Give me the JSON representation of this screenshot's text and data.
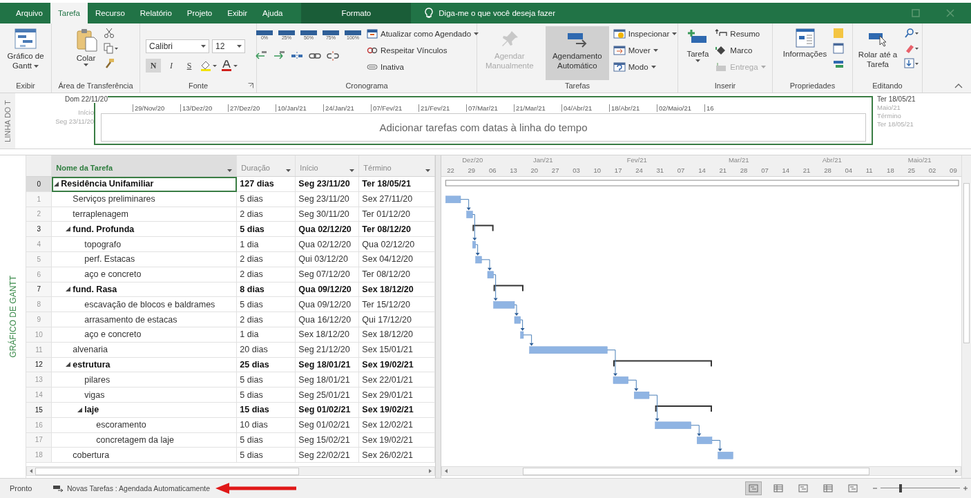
{
  "tabs": [
    {
      "label": "Arquivo",
      "selected": false,
      "kind": "normal"
    },
    {
      "label": "Tarefa",
      "selected": true,
      "kind": "normal"
    },
    {
      "label": "Recurso",
      "selected": false,
      "kind": "normal"
    },
    {
      "label": "Relatório",
      "selected": false,
      "kind": "normal"
    },
    {
      "label": "Projeto",
      "selected": false,
      "kind": "normal"
    },
    {
      "label": "Exibir",
      "selected": false,
      "kind": "normal"
    },
    {
      "label": "Ajuda",
      "selected": false,
      "kind": "normal"
    },
    {
      "label": "Formato",
      "selected": false,
      "kind": "contextual"
    }
  ],
  "tell_me": {
    "placeholder": "Diga-me o que você deseja fazer"
  },
  "ribbon": {
    "view": {
      "label": "Exibir",
      "gantt_button": "Gráfico de Gantt"
    },
    "clipboard": {
      "label": "Área de Transferência",
      "paste_button": "Colar"
    },
    "font": {
      "label": "Fonte",
      "family": "Calibri",
      "size": "12",
      "bold": "N",
      "italic": "I",
      "underline": "S"
    },
    "schedule": {
      "label": "Cronograma",
      "percent_labels": [
        "0%",
        "25%",
        "50%",
        "75%",
        "100%"
      ],
      "commands": [
        "Atualizar como Agendado",
        "Respeitar Vínculos",
        "Inativa"
      ]
    },
    "tasks": {
      "label": "Tarefas",
      "modes": [
        {
          "label": "Agendar Manualmente",
          "selected": false,
          "disabled": true
        },
        {
          "label": "Agendamento Automático",
          "selected": true,
          "disabled": false
        }
      ],
      "commands": [
        "Inspecionar",
        "Mover",
        "Modo"
      ]
    },
    "insert": {
      "label": "Inserir",
      "task_button": "Tarefa",
      "commands": [
        {
          "label": "Resumo",
          "disabled": false
        },
        {
          "label": "Marco",
          "disabled": false
        },
        {
          "label": "Entrega",
          "disabled": true
        }
      ]
    },
    "properties": {
      "label": "Propriedades",
      "info_button": "Informações"
    },
    "editing": {
      "label": "Editando",
      "scroll_button": "Rolar até a Tarefa"
    }
  },
  "timeline": {
    "side_label": "LINHA DO T",
    "start_top": "Dom 22/11/20",
    "start_caption": "Início",
    "start_date": "Seg 23/11/20",
    "ticks": [
      "29/Nov/20",
      "13/Dez/20",
      "27/Dez/20",
      "10/Jan/21",
      "24/Jan/21",
      "07/Fev/21",
      "21/Fev/21",
      "07/Mar/21",
      "21/Mar/21",
      "04/Abr/21",
      "18/Abr/21",
      "02/Maio/21",
      "16"
    ],
    "placeholder_text": "Adicionar tarefas com datas à linha do tempo",
    "end_top": "Ter 18/05/21",
    "end_month": "Maio/21",
    "end_caption": "Término",
    "end_date": "Ter 18/05/21"
  },
  "view_label": "GRÁFICO DE GANTT",
  "table": {
    "columns": [
      "Nome da Tarefa",
      "Duração",
      "Início",
      "Término"
    ],
    "rows": [
      {
        "num": "0",
        "name": "Residência Unifamiliar",
        "duration": "127 dias",
        "start": "Seg 23/11/20",
        "finish": "Ter 18/05/21",
        "kind": "summary",
        "expanded": true,
        "selected": true,
        "children": [
          {
            "num": "1",
            "name": "Serviços preliminares",
            "duration": "5 dias",
            "start": "Seg 23/11/20",
            "finish": "Sex 27/11/20",
            "kind": "task",
            "selected": false
          },
          {
            "num": "2",
            "name": "terraplenagem",
            "duration": "2 dias",
            "start": "Seg 30/11/20",
            "finish": "Ter 01/12/20",
            "kind": "task",
            "selected": false
          },
          {
            "num": "3",
            "name": "fund. Profunda",
            "duration": "5 dias",
            "start": "Qua 02/12/20",
            "finish": "Ter 08/12/20",
            "kind": "summary",
            "expanded": true,
            "selected": false,
            "children": [
              {
                "num": "4",
                "name": "topografo",
                "duration": "1 dia",
                "start": "Qua 02/12/20",
                "finish": "Qua 02/12/20",
                "kind": "task",
                "selected": false
              },
              {
                "num": "5",
                "name": "perf. Estacas",
                "duration": "2 dias",
                "start": "Qui 03/12/20",
                "finish": "Sex 04/12/20",
                "kind": "task",
                "selected": false
              },
              {
                "num": "6",
                "name": "aço e concreto",
                "duration": "2 dias",
                "start": "Seg 07/12/20",
                "finish": "Ter 08/12/20",
                "kind": "task",
                "selected": false
              }
            ]
          },
          {
            "num": "7",
            "name": "fund. Rasa",
            "duration": "8 dias",
            "start": "Qua 09/12/20",
            "finish": "Sex 18/12/20",
            "kind": "summary",
            "expanded": true,
            "selected": false,
            "children": [
              {
                "num": "8",
                "name": "escavação de blocos e baldrames",
                "duration": "5 dias",
                "start": "Qua 09/12/20",
                "finish": "Ter 15/12/20",
                "kind": "task",
                "selected": false
              },
              {
                "num": "9",
                "name": "arrasamento de estacas",
                "duration": "2 dias",
                "start": "Qua 16/12/20",
                "finish": "Qui 17/12/20",
                "kind": "task",
                "selected": false
              },
              {
                "num": "10",
                "name": "aço e concreto",
                "duration": "1 dia",
                "start": "Sex 18/12/20",
                "finish": "Sex 18/12/20",
                "kind": "task",
                "selected": false
              }
            ]
          },
          {
            "num": "11",
            "name": "alvenaria",
            "duration": "20 dias",
            "start": "Seg 21/12/20",
            "finish": "Sex 15/01/21",
            "kind": "task",
            "selected": false
          },
          {
            "num": "12",
            "name": "estrutura",
            "duration": "25 dias",
            "start": "Seg 18/01/21",
            "finish": "Sex 19/02/21",
            "kind": "summary",
            "expanded": true,
            "selected": false,
            "children": [
              {
                "num": "13",
                "name": "pilares",
                "duration": "5 dias",
                "start": "Seg 18/01/21",
                "finish": "Sex 22/01/21",
                "kind": "task",
                "selected": false
              },
              {
                "num": "14",
                "name": "vigas",
                "duration": "5 dias",
                "start": "Seg 25/01/21",
                "finish": "Sex 29/01/21",
                "kind": "task",
                "selected": false
              },
              {
                "num": "15",
                "name": "laje",
                "duration": "15 dias",
                "start": "Seg 01/02/21",
                "finish": "Sex 19/02/21",
                "kind": "summary",
                "expanded": true,
                "selected": false,
                "children": [
                  {
                    "num": "16",
                    "name": "escoramento",
                    "duration": "10 dias",
                    "start": "Seg 01/02/21",
                    "finish": "Sex 12/02/21",
                    "kind": "task",
                    "selected": false
                  },
                  {
                    "num": "17",
                    "name": "concretagem da laje",
                    "duration": "5 dias",
                    "start": "Seg 15/02/21",
                    "finish": "Sex 19/02/21",
                    "kind": "task",
                    "selected": false
                  }
                ]
              }
            ]
          },
          {
            "num": "18",
            "name": "cobertura",
            "duration": "5 dias",
            "start": "Seg 22/02/21",
            "finish": "Sex 26/02/21",
            "kind": "task",
            "selected": false
          }
        ]
      }
    ]
  },
  "gantt": {
    "months": [
      "Dez/20",
      "Jan/21",
      "Fev/21",
      "Mar/21",
      "Abr/21",
      "Maio/21"
    ],
    "days": [
      "22",
      "29",
      "06",
      "13",
      "20",
      "27",
      "03",
      "10",
      "17",
      "24",
      "31",
      "07",
      "14",
      "21",
      "28",
      "07",
      "14",
      "21",
      "28",
      "04",
      "11",
      "18",
      "25",
      "02",
      "09"
    ]
  },
  "status_bar": {
    "status": "Pronto",
    "new_tasks": "Novas Tarefas : Agendada Automaticamente",
    "views": [
      {
        "selected": true
      },
      {
        "selected": false
      },
      {
        "selected": false
      },
      {
        "selected": false
      },
      {
        "selected": false
      }
    ],
    "zoom": {
      "level": 0.25
    }
  }
}
